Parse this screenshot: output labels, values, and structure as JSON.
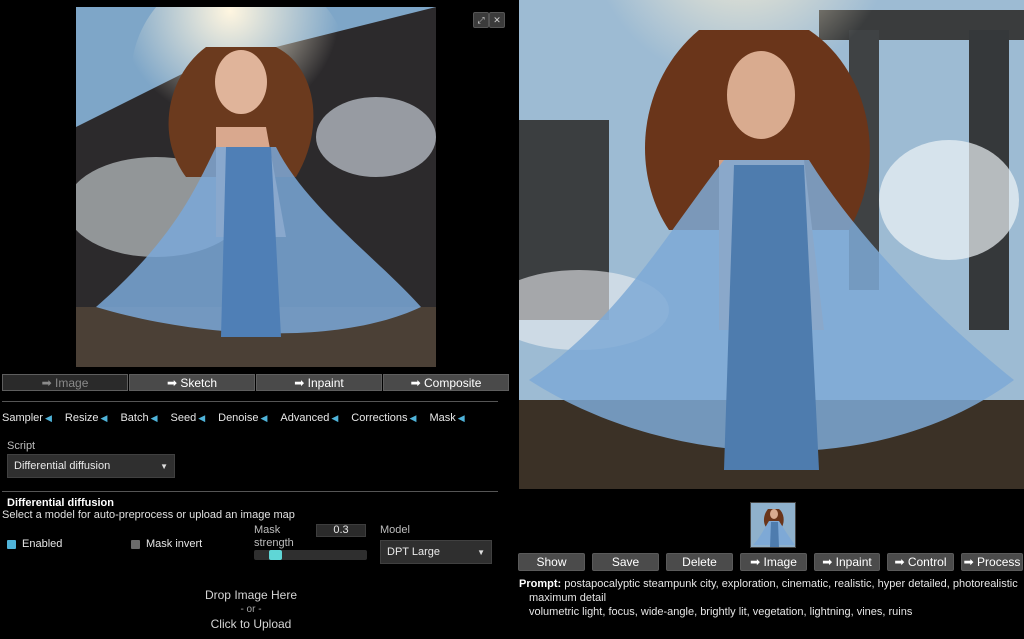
{
  "input_image": {
    "alt": "generated image",
    "toolbar": {
      "expand_icon": "expand-icon",
      "close_icon": "close-icon"
    }
  },
  "tabs": [
    {
      "label": "➡ Image",
      "active": true
    },
    {
      "label": "➡ Sketch",
      "active": false
    },
    {
      "label": "➡ Inpaint",
      "active": false
    },
    {
      "label": "➡ Composite",
      "active": false
    }
  ],
  "accordions": [
    "Sampler",
    "Resize",
    "Batch",
    "Seed",
    "Denoise",
    "Advanced",
    "Corrections",
    "Mask"
  ],
  "script": {
    "label": "Script",
    "value": "Differential diffusion"
  },
  "diff": {
    "title": "Differential diffusion",
    "description": "Select a model for auto-preprocess or upload an image map",
    "enabled_label": "Enabled",
    "enabled": true,
    "mask_invert_label": "Mask invert",
    "mask_invert": false,
    "mask_strength_label": "Mask strength",
    "mask_strength_value": "0.3",
    "mask_strength_fraction": 0.3,
    "model_label": "Model",
    "model_value": "DPT Large"
  },
  "upload": {
    "line1": "Drop Image Here",
    "line2": "- or -",
    "line3": "Click to Upload"
  },
  "gallery_buttons": [
    "Show",
    "Save",
    "Delete",
    "➡ Image",
    "➡ Inpaint",
    "➡ Control",
    "➡ Process"
  ],
  "prompt": {
    "label": "Prompt:",
    "line1": "postapocalyptic steampunk city, exploration, cinematic, realistic, hyper detailed, photorealistic",
    "line2": "maximum detail",
    "line3": "volumetric light, focus, wide-angle, brightly lit, vegetation, lightning, vines, ruins"
  },
  "colors": {
    "accent": "#4fb3d9",
    "slider": "#5fd6d6",
    "background": "#000000",
    "button": "#4b4b4b"
  }
}
